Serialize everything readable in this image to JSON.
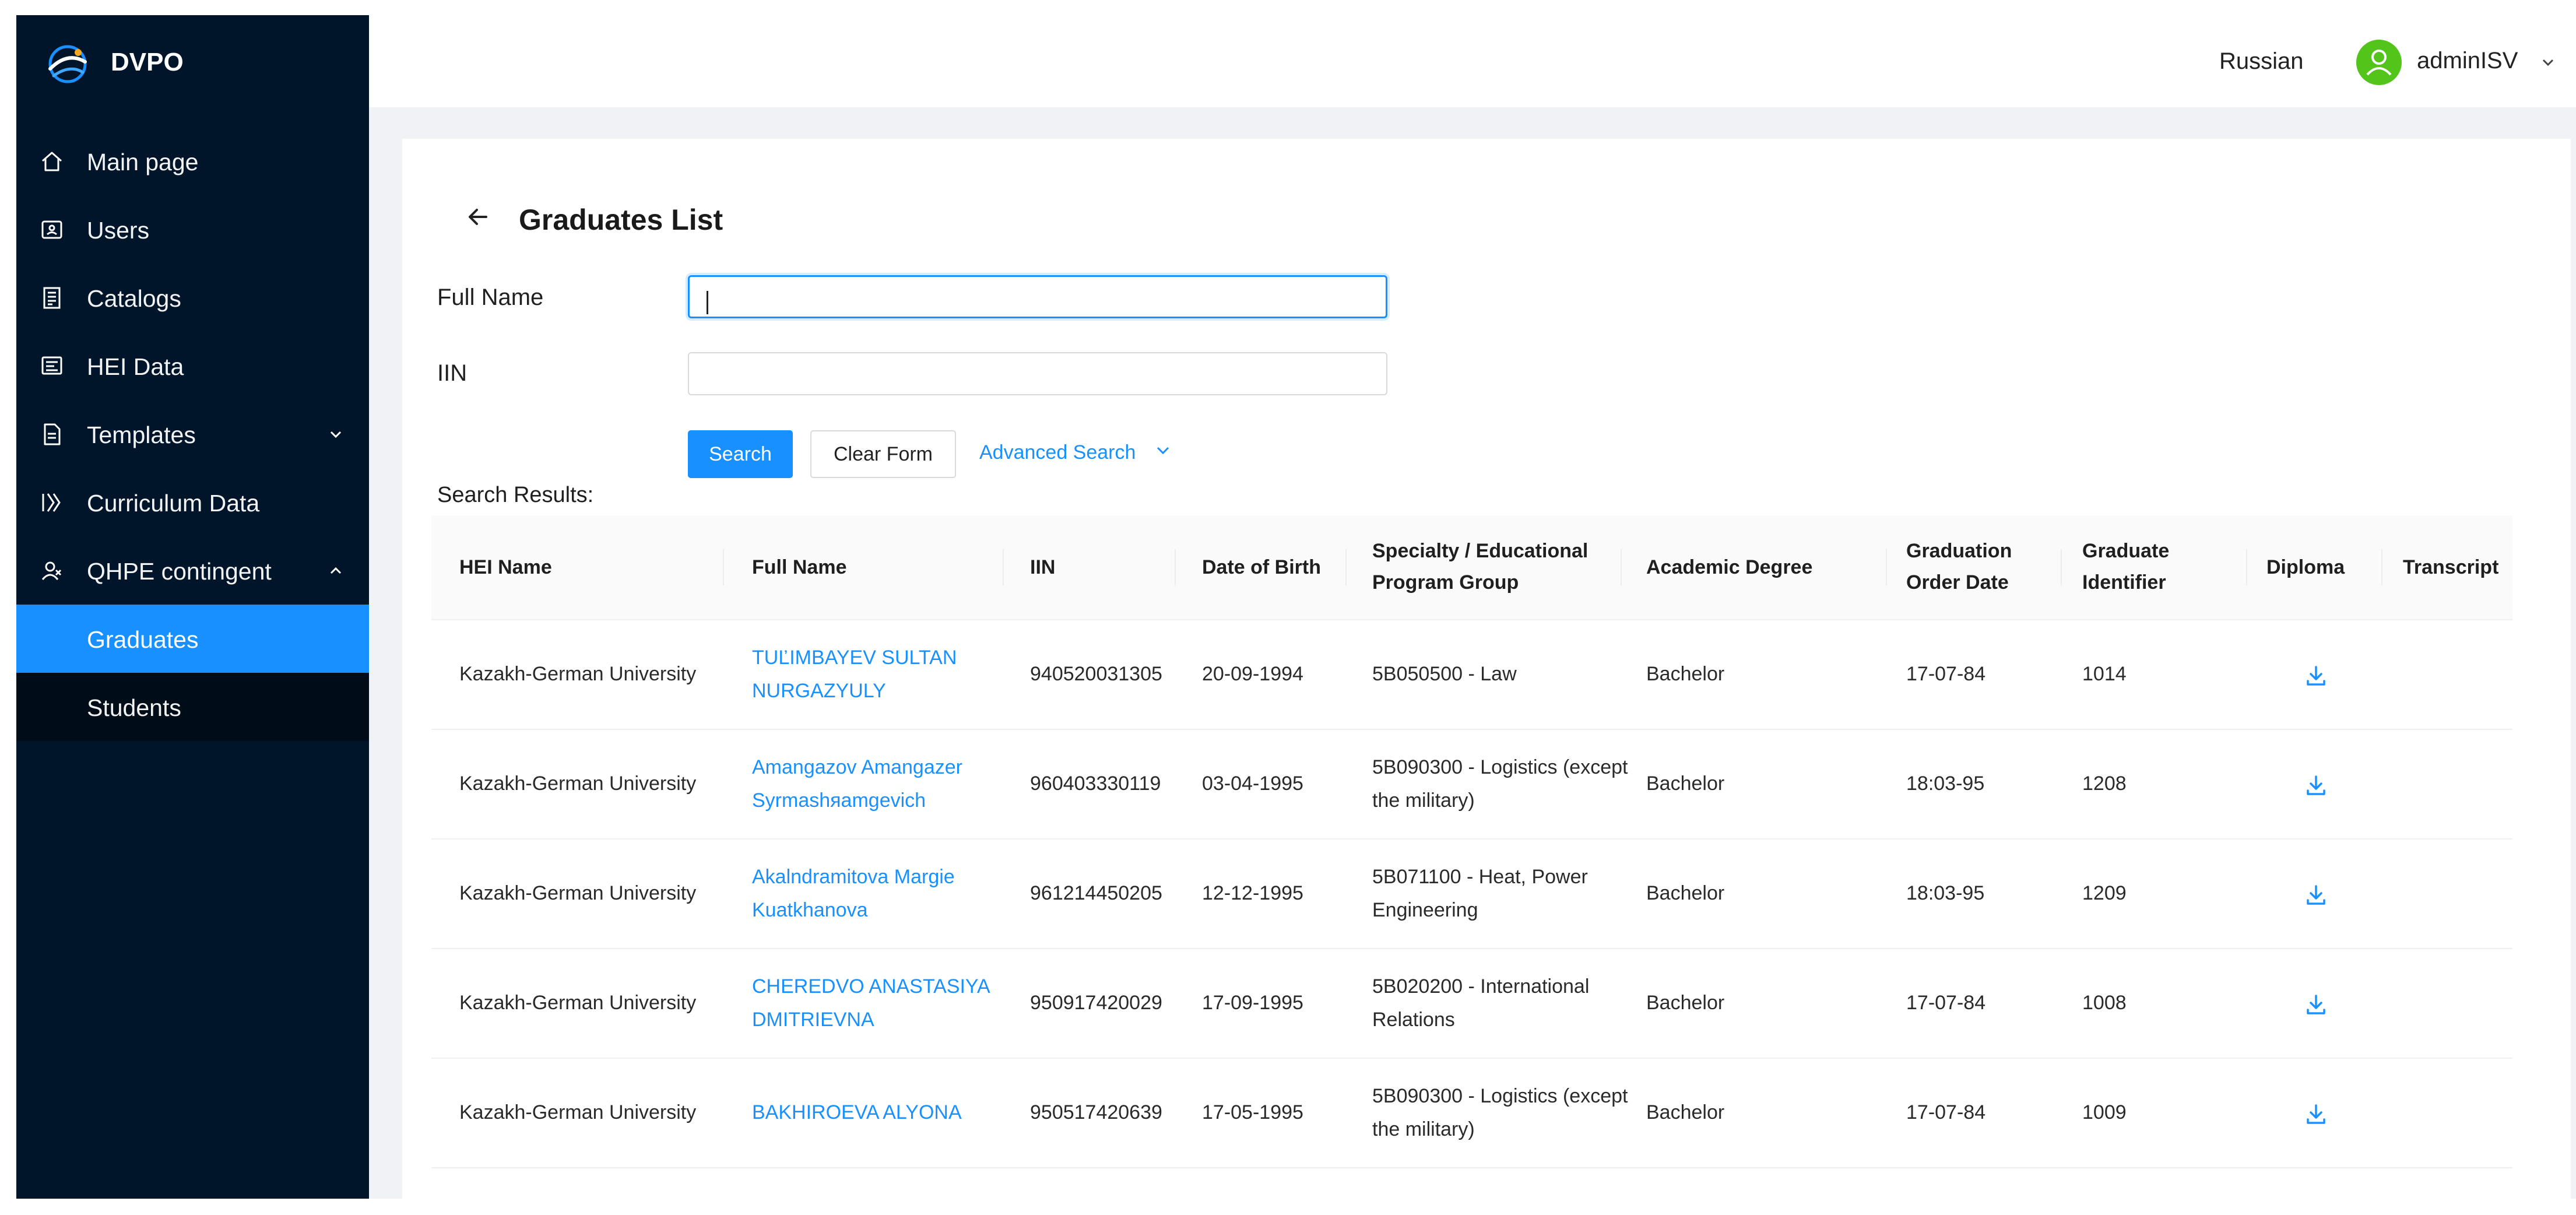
{
  "app": {
    "logo_text": "DVPO"
  },
  "sidebar": {
    "items": [
      {
        "label": "Main page",
        "icon": "home-icon"
      },
      {
        "label": "Users",
        "icon": "users-icon"
      },
      {
        "label": "Catalogs",
        "icon": "catalog-icon"
      },
      {
        "label": "HEI Data",
        "icon": "hei-data-icon"
      },
      {
        "label": "Templates",
        "icon": "template-icon",
        "expandable": true,
        "expanded": false
      },
      {
        "label": "Curriculum Data",
        "icon": "curriculum-icon"
      },
      {
        "label": "QHPE contingent",
        "icon": "contingent-icon",
        "expandable": true,
        "expanded": true
      }
    ],
    "submenu": [
      {
        "label": "Graduates",
        "active": true
      },
      {
        "label": "Students",
        "active": false
      }
    ]
  },
  "header": {
    "language": "Russian",
    "user_name": "adminISV"
  },
  "page": {
    "title": "Graduates List"
  },
  "form": {
    "full_name_label": "Full Name",
    "full_name_value": "",
    "iin_label": "IIN",
    "iin_value": "",
    "search_label": "Search",
    "clear_label": "Clear Form",
    "advanced_label": "Advanced Search"
  },
  "results": {
    "label": "Search Results:",
    "columns": [
      {
        "line1": "HEI Name",
        "line2": ""
      },
      {
        "line1": "Full Name",
        "line2": ""
      },
      {
        "line1": "IIN",
        "line2": ""
      },
      {
        "line1": "Date of Birth",
        "line2": ""
      },
      {
        "line1": "Specialty / Educational",
        "line2": "Program Group"
      },
      {
        "line1": "Academic Degree",
        "line2": ""
      },
      {
        "line1": "Graduation",
        "line2": "Order Date"
      },
      {
        "line1": "Graduate",
        "line2": "Identifier"
      },
      {
        "line1": "Diploma",
        "line2": ""
      },
      {
        "line1": "Transcript",
        "line2": ""
      }
    ],
    "rows": [
      {
        "hei": "Kazakh-German University",
        "name1": "TUĽIMBAYEV SULTAN",
        "name2": "NURGAZYULY",
        "iin": "940520031305",
        "dob": "20-09-1994",
        "spec1": "5B050500 - Law",
        "spec2": "",
        "degree": "Bachelor",
        "order_date": "17-07-84",
        "identifier": "1014"
      },
      {
        "hei": "Kazakh-German University",
        "name1": "Amangazov Amangazer",
        "name2": "Syrmashяamgevich",
        "iin": "960403330119",
        "dob": "03-04-1995",
        "spec1": "5B090300 - Logistics (except",
        "spec2": "the military)",
        "degree": "Bachelor",
        "order_date": "18:03-95",
        "identifier": "1208"
      },
      {
        "hei": "Kazakh-German University",
        "name1": "Akalndramitova Margie",
        "name2": "Kuatkhanova",
        "iin": "961214450205",
        "dob": "12-12-1995",
        "spec1": "5B071100 - Heat, Power",
        "spec2": "Engineering",
        "degree": "Bachelor",
        "order_date": "18:03-95",
        "identifier": "1209"
      },
      {
        "hei": "Kazakh-German University",
        "name1": "CHEREDVO ANASTASIYA",
        "name2": "DMITRIEVNA",
        "iin": "950917420029",
        "dob": "17-09-1995",
        "spec1": "5B020200 - International",
        "spec2": "Relations",
        "degree": "Bachelor",
        "order_date": "17-07-84",
        "identifier": "1008"
      },
      {
        "hei": "Kazakh-German University",
        "name1": "BAKHIROEVA ALYONA",
        "name2": "",
        "iin": "950517420639",
        "dob": "17-05-1995",
        "spec1": "5B090300 - Logistics (except",
        "spec2": "the military)",
        "degree": "Bachelor",
        "order_date": "17-07-84",
        "identifier": "1009"
      }
    ]
  },
  "colors": {
    "sidebar_bg": "#001529",
    "submenu_bg": "#000c17",
    "accent": "#1890ff",
    "avatar": "#52c41a"
  }
}
